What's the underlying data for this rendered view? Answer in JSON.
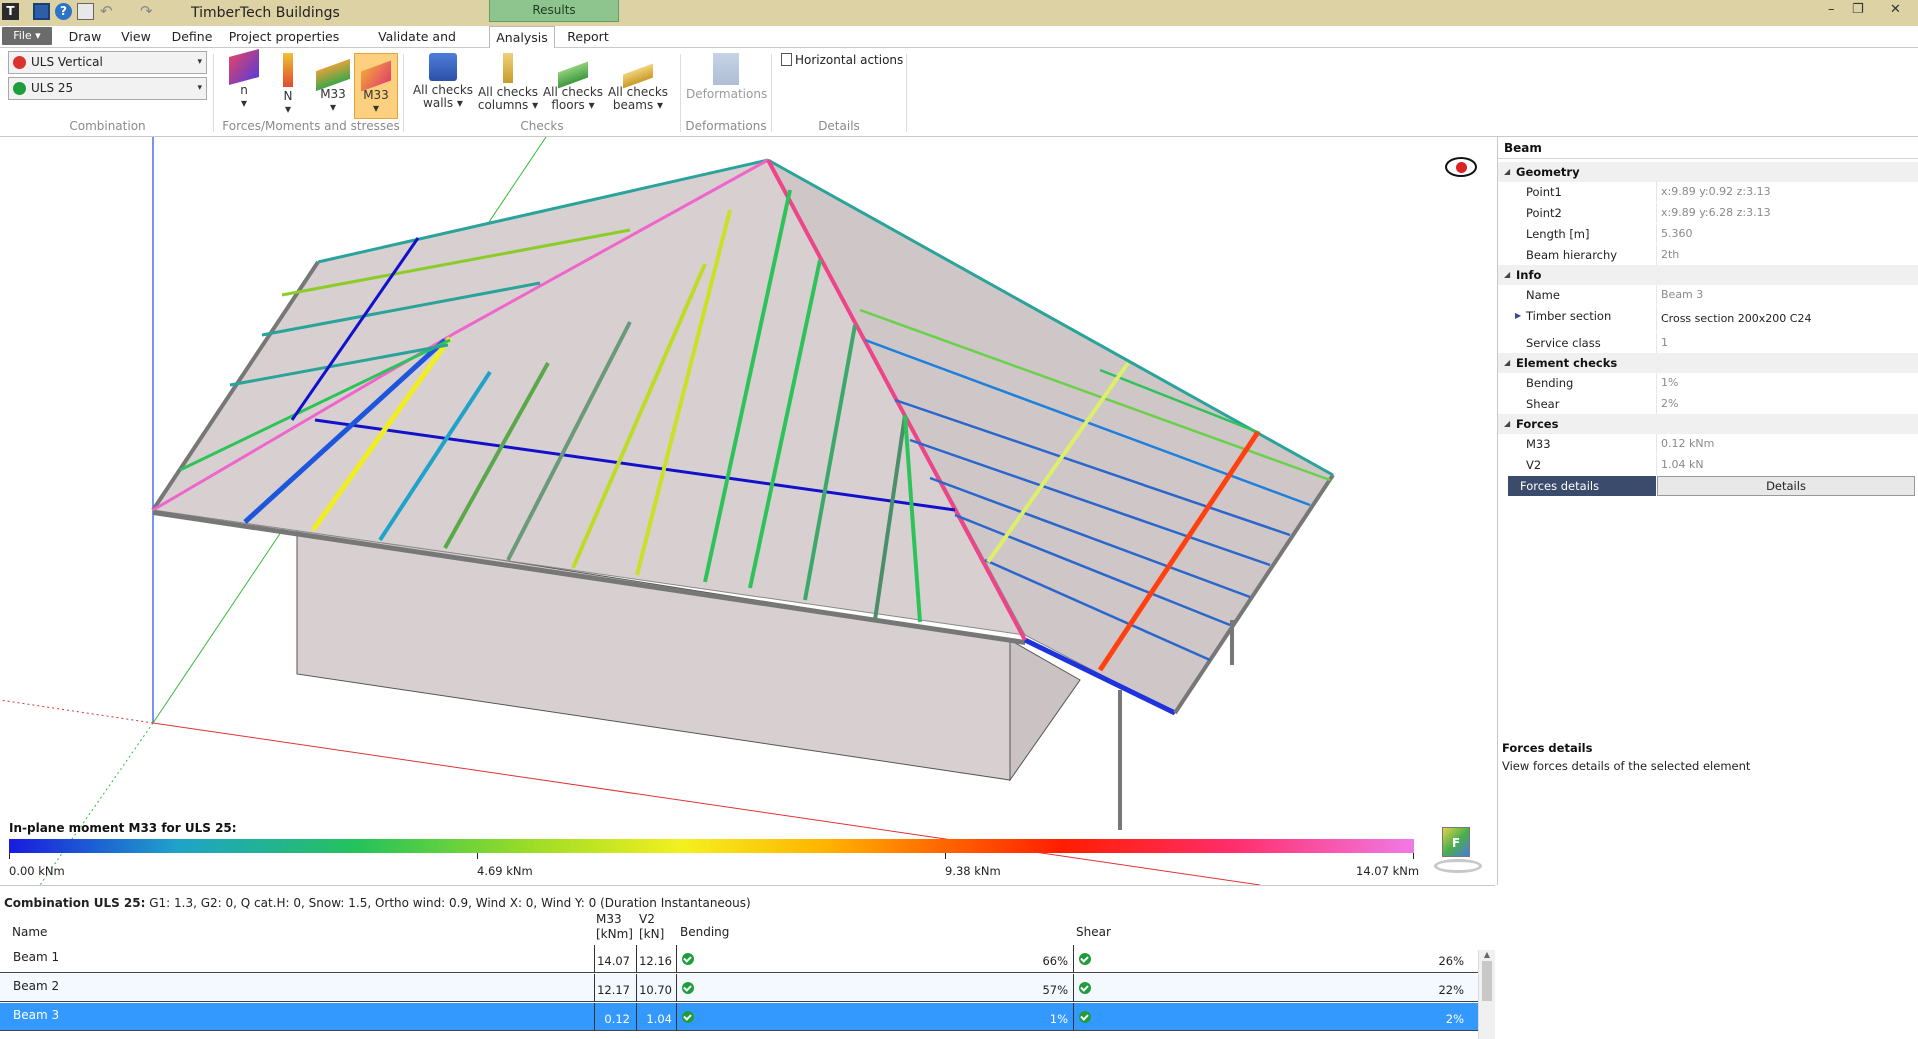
{
  "app": {
    "title": "TimberTech Buildings",
    "context_tab": "Results"
  },
  "tabs": {
    "file": "File ▾",
    "draw": "Draw",
    "view": "View",
    "define": "Define",
    "project": "Project properties",
    "validate": "Validate and Calculate",
    "analysis": "Analysis",
    "report": "Report"
  },
  "ribbon": {
    "combination": {
      "first": "ULS Vertical",
      "second": "ULS 25",
      "label": "Combination"
    },
    "forces": {
      "n": "n",
      "N": "N",
      "m33a": "M33",
      "m33b": "M33",
      "label": "Forces/Moments and stresses"
    },
    "checks": {
      "walls1": "All checks",
      "walls2": "walls ▾",
      "cols1": "All checks",
      "cols2": "columns ▾",
      "floors1": "All checks",
      "floors2": "floors ▾",
      "beams1": "All checks",
      "beams2": "beams ▾",
      "label": "Checks"
    },
    "deformations": {
      "btn": "Deformations",
      "label": "Deformations"
    },
    "details": {
      "horizontal": "Horizontal actions",
      "label": "Details"
    }
  },
  "legend": {
    "title": "In-plane moment M33 for ULS 25:",
    "ticks": [
      "0.00 kNm",
      "4.69 kNm",
      "9.38 kNm",
      "14.07 kNm"
    ]
  },
  "properties": {
    "header": "Beam",
    "geometry": "Geometry",
    "point1_k": "Point1",
    "point1_v": "x:9.89 y:0.92 z:3.13",
    "point2_k": "Point2",
    "point2_v": "x:9.89 y:6.28 z:3.13",
    "length_k": "Length [m]",
    "length_v": "5.360",
    "hier_k": "Beam hierarchy",
    "hier_v": "2th",
    "info": "Info",
    "name_k": "Name",
    "name_v": "Beam 3",
    "section_k": "Timber section",
    "section_v": "Cross section 200x200 C24",
    "service_k": "Service class",
    "service_v": "1",
    "checks": "Element checks",
    "bending_k": "Bending",
    "bending_v": "1%",
    "shear_k": "Shear",
    "shear_v": "2%",
    "forces": "Forces",
    "m33_k": "M33",
    "m33_v": "0.12 kNm",
    "v2_k": "V2",
    "v2_v": "1.04 kN",
    "fd_k": "Forces details",
    "fd_v": "Details"
  },
  "help": {
    "title": "Forces details",
    "text": "View forces details of the selected element"
  },
  "results": {
    "combo_bold": "Combination ULS 25:",
    "combo_text": " G1: 1.3, G2: 0, Q cat.H: 0, Snow: 1.5, Ortho wind: 0.9, Wind X: 0, Wind Y: 0 (Duration Instantaneous)",
    "headers": {
      "name": "Name",
      "m33a": "M33",
      "m33b": "[kNm]",
      "v2a": "V2",
      "v2b": "[kN]",
      "bending": "Bending",
      "shear": "Shear"
    },
    "rows": [
      {
        "name": "Beam 1",
        "m33": "14.07",
        "v2": "12.16",
        "bending": "66%",
        "shear": "26%"
      },
      {
        "name": "Beam 2",
        "m33": "12.17",
        "v2": "10.70",
        "bending": "57%",
        "shear": "22%"
      },
      {
        "name": "Beam 3",
        "m33": "0.12",
        "v2": "1.04",
        "bending": "1%",
        "shear": "2%"
      }
    ]
  },
  "colors": {
    "accent": "#3399ff",
    "ok": "#1f9d3d",
    "error": "#d9322f",
    "titlebar": "#dcd2a3"
  }
}
